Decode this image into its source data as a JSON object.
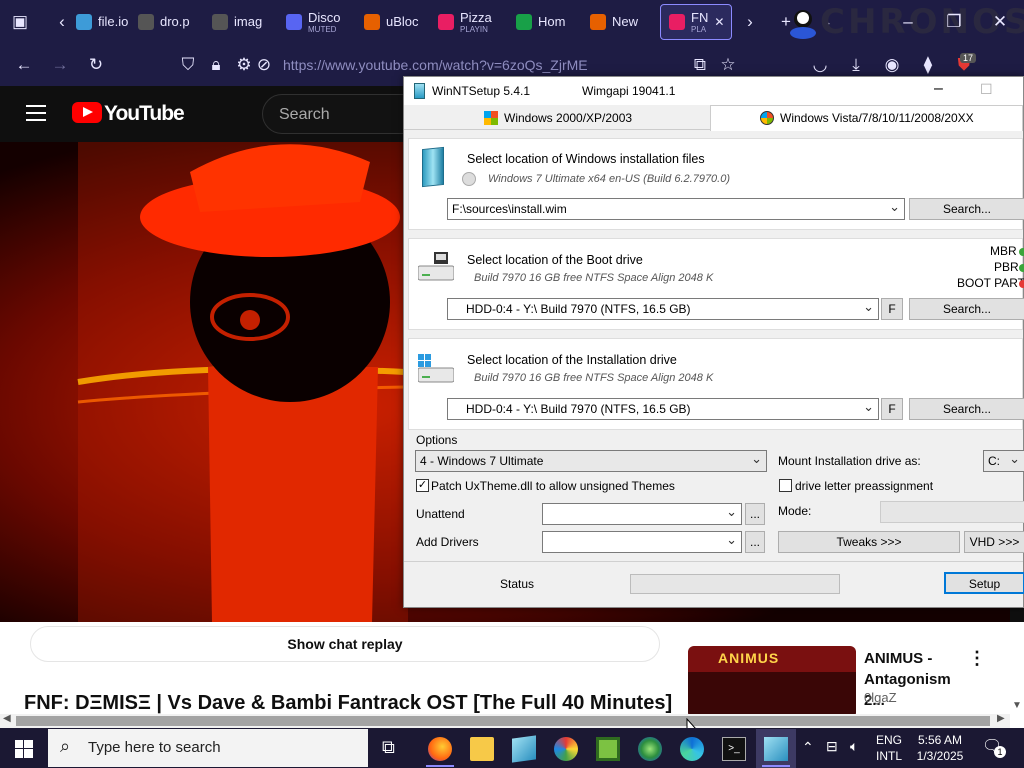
{
  "browser": {
    "tabs": [
      {
        "title": "file.io",
        "color": "#3d9bd8"
      },
      {
        "title": "dro.p",
        "color": "#555"
      },
      {
        "title": "imag",
        "color": "#555"
      },
      {
        "title": "Disco",
        "sub": "MUTED",
        "color": "#5865f2"
      },
      {
        "title": "uBloc",
        "color": "#e66000"
      },
      {
        "title": "Pizza",
        "sub": "PLAYIN",
        "color": "#e91e63"
      },
      {
        "title": "Hom",
        "color": "#18a048"
      },
      {
        "title": "New",
        "color": "#e66000"
      },
      {
        "title": "FN",
        "sub": "PLA",
        "color": "#e91e63"
      }
    ],
    "brand_text": "CHRONOS",
    "url": "https://www.youtube.com/watch?v=6zoQs_ZjrME",
    "extension_badge": "17"
  },
  "youtube": {
    "logo_text": "YouTube",
    "search_placeholder": "Search",
    "show_chat": "Show chat replay",
    "video_title": "FNF: DΞMISΞ | Vs Dave & Bambi Fantrack OST [The Full 40 Minutes]",
    "rec_title": "ANIMUS - Antagonism 2...",
    "rec_channel": "0lgaZ",
    "rec_thumb_text": "ANIMUS"
  },
  "winnt": {
    "title": "WinNTSetup 5.4.1",
    "wimgapi": "Wimgapi 19041.1",
    "tab1": "Windows 2000/XP/2003",
    "tab2": "Windows Vista/7/8/10/11/2008/20XX",
    "sec1_title": "Select location of Windows installation files",
    "sec1_sub": "Windows 7 Ultimate  x64 en-US (Build 6.2.7970.0)",
    "sec1_value": "F:\\sources\\install.wim",
    "search": "Search...",
    "sec2_title": "Select location of the Boot drive",
    "sec2_sub": "Build 7970 16 GB free NTFS Space Align 2048 K",
    "drive_value": "HDD-0:4 - Y:\\ Build 7970 (NTFS, 16.5 GB)",
    "f_button": "F",
    "mbr": "MBR",
    "pbr": "PBR",
    "bootpart": "BOOT PART",
    "sec3_title": "Select location of the Installation drive",
    "sec3_sub": "Build 7970 16 GB free NTFS Space Align 2048 K",
    "options_label": "Options",
    "edition_value": "4 - Windows 7 Ultimate",
    "mount_label": "Mount Installation drive as:",
    "mount_value": "C:",
    "patch_label": "Patch UxTheme.dll to allow unsigned Themes",
    "preassign_label": "drive letter preassignment",
    "unattend_label": "Unattend",
    "mode_label": "Mode:",
    "drivers_label": "Add Drivers",
    "tweaks": "Tweaks >>>",
    "vhd": "VHD >>>",
    "status_label": "Status",
    "setup": "Setup",
    "ellipsis": "..."
  },
  "taskbar": {
    "search_placeholder": "Type here to search",
    "lang1": "ENG",
    "lang2": "INTL",
    "time": "5:56 AM",
    "date": "1/3/2025",
    "notif": "1"
  }
}
